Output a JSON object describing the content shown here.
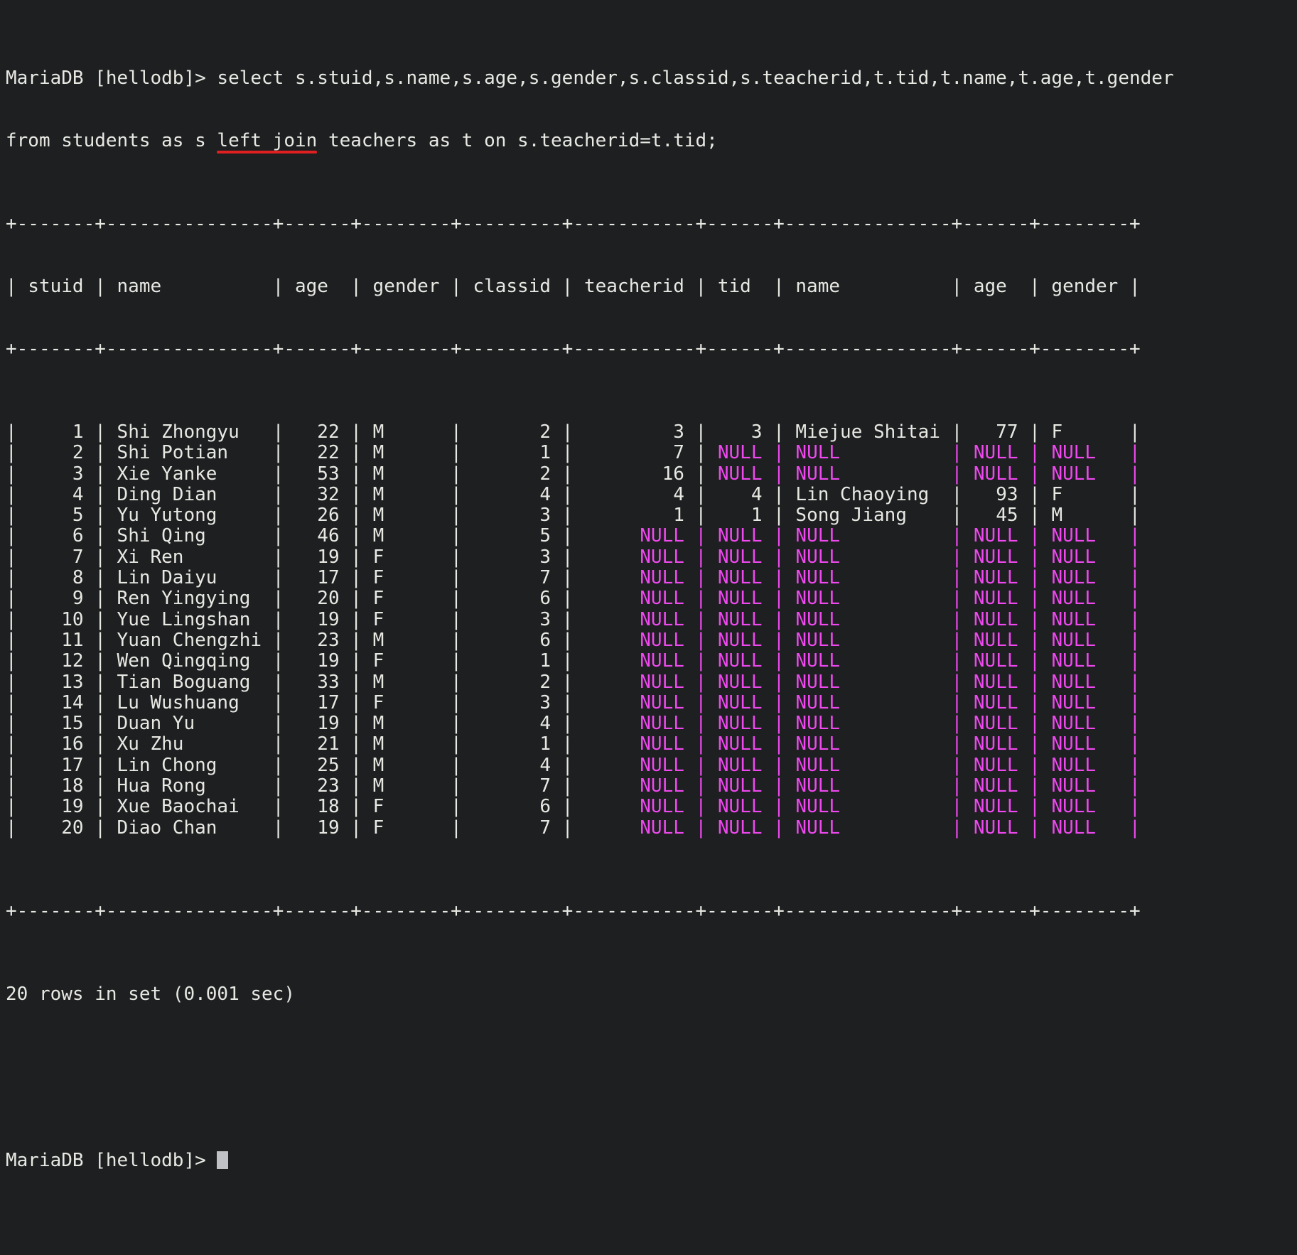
{
  "terminal": {
    "prompt": "MariaDB [hellodb]> ",
    "prompt_bare": "MariaDB [hellodb]>",
    "colors": {
      "background": "#1d1f21",
      "foreground": "#e8e8e3",
      "null_value": "#ef48ef",
      "annotation_underline": "#e02020",
      "cursor": "#bfc1c6"
    },
    "command_line_1": "MariaDB [hellodb]> select s.stuid,s.name,s.age,s.gender,s.classid,s.teacherid,t.tid,t.name,t.age,t.gender",
    "command_line_2": "from students as s left join teachers as t on s.teacherid=t.tid;",
    "sql_query": "select s.stuid,s.name,s.age,s.gender,s.classid,s.teacherid,t.tid,t.name,t.age,t.gender from students as s left join teachers as t on s.teacherid=t.tid;",
    "annotation": {
      "target_text": "left join",
      "type": "red-underline"
    },
    "result_footer": "20 rows in set (0.001 sec)",
    "row_count": 20,
    "elapsed": "0.001 sec",
    "final_prompt": "MariaDB [hellodb]> "
  },
  "table": {
    "separator": "+-------+---------------+------+--------+---------+-----------+------+---------------+------+--------+",
    "columns": [
      {
        "name": "stuid",
        "width": 5,
        "align": "right"
      },
      {
        "name": "name",
        "width": 13,
        "align": "left"
      },
      {
        "name": "age",
        "width": 4,
        "align": "right"
      },
      {
        "name": "gender",
        "width": 6,
        "align": "left"
      },
      {
        "name": "classid",
        "width": 7,
        "align": "right"
      },
      {
        "name": "teacherid",
        "width": 9,
        "align": "right"
      },
      {
        "name": "tid",
        "width": 4,
        "align": "right"
      },
      {
        "name": "name",
        "width": 13,
        "align": "left"
      },
      {
        "name": "age",
        "width": 4,
        "align": "right"
      },
      {
        "name": "gender",
        "width": 6,
        "align": "left"
      }
    ],
    "rows": [
      {
        "stuid": "1",
        "name": "Shi Zhongyu",
        "age": "22",
        "gender": "M",
        "classid": "2",
        "teacherid": "3",
        "tid": "3",
        "tname": "Miejue Shitai",
        "tage": "77",
        "tgender": "F"
      },
      {
        "stuid": "2",
        "name": "Shi Potian",
        "age": "22",
        "gender": "M",
        "classid": "1",
        "teacherid": "7",
        "tid": "NULL",
        "tname": "NULL",
        "tage": "NULL",
        "tgender": "NULL"
      },
      {
        "stuid": "3",
        "name": "Xie Yanke",
        "age": "53",
        "gender": "M",
        "classid": "2",
        "teacherid": "16",
        "tid": "NULL",
        "tname": "NULL",
        "tage": "NULL",
        "tgender": "NULL"
      },
      {
        "stuid": "4",
        "name": "Ding Dian",
        "age": "32",
        "gender": "M",
        "classid": "4",
        "teacherid": "4",
        "tid": "4",
        "tname": "Lin Chaoying",
        "tage": "93",
        "tgender": "F"
      },
      {
        "stuid": "5",
        "name": "Yu Yutong",
        "age": "26",
        "gender": "M",
        "classid": "3",
        "teacherid": "1",
        "tid": "1",
        "tname": "Song Jiang",
        "tage": "45",
        "tgender": "M"
      },
      {
        "stuid": "6",
        "name": "Shi Qing",
        "age": "46",
        "gender": "M",
        "classid": "5",
        "teacherid": "NULL",
        "tid": "NULL",
        "tname": "NULL",
        "tage": "NULL",
        "tgender": "NULL"
      },
      {
        "stuid": "7",
        "name": "Xi Ren",
        "age": "19",
        "gender": "F",
        "classid": "3",
        "teacherid": "NULL",
        "tid": "NULL",
        "tname": "NULL",
        "tage": "NULL",
        "tgender": "NULL"
      },
      {
        "stuid": "8",
        "name": "Lin Daiyu",
        "age": "17",
        "gender": "F",
        "classid": "7",
        "teacherid": "NULL",
        "tid": "NULL",
        "tname": "NULL",
        "tage": "NULL",
        "tgender": "NULL"
      },
      {
        "stuid": "9",
        "name": "Ren Yingying",
        "age": "20",
        "gender": "F",
        "classid": "6",
        "teacherid": "NULL",
        "tid": "NULL",
        "tname": "NULL",
        "tage": "NULL",
        "tgender": "NULL"
      },
      {
        "stuid": "10",
        "name": "Yue Lingshan",
        "age": "19",
        "gender": "F",
        "classid": "3",
        "teacherid": "NULL",
        "tid": "NULL",
        "tname": "NULL",
        "tage": "NULL",
        "tgender": "NULL"
      },
      {
        "stuid": "11",
        "name": "Yuan Chengzhi",
        "age": "23",
        "gender": "M",
        "classid": "6",
        "teacherid": "NULL",
        "tid": "NULL",
        "tname": "NULL",
        "tage": "NULL",
        "tgender": "NULL"
      },
      {
        "stuid": "12",
        "name": "Wen Qingqing",
        "age": "19",
        "gender": "F",
        "classid": "1",
        "teacherid": "NULL",
        "tid": "NULL",
        "tname": "NULL",
        "tage": "NULL",
        "tgender": "NULL"
      },
      {
        "stuid": "13",
        "name": "Tian Boguang",
        "age": "33",
        "gender": "M",
        "classid": "2",
        "teacherid": "NULL",
        "tid": "NULL",
        "tname": "NULL",
        "tage": "NULL",
        "tgender": "NULL"
      },
      {
        "stuid": "14",
        "name": "Lu Wushuang",
        "age": "17",
        "gender": "F",
        "classid": "3",
        "teacherid": "NULL",
        "tid": "NULL",
        "tname": "NULL",
        "tage": "NULL",
        "tgender": "NULL"
      },
      {
        "stuid": "15",
        "name": "Duan Yu",
        "age": "19",
        "gender": "M",
        "classid": "4",
        "teacherid": "NULL",
        "tid": "NULL",
        "tname": "NULL",
        "tage": "NULL",
        "tgender": "NULL"
      },
      {
        "stuid": "16",
        "name": "Xu Zhu",
        "age": "21",
        "gender": "M",
        "classid": "1",
        "teacherid": "NULL",
        "tid": "NULL",
        "tname": "NULL",
        "tage": "NULL",
        "tgender": "NULL"
      },
      {
        "stuid": "17",
        "name": "Lin Chong",
        "age": "25",
        "gender": "M",
        "classid": "4",
        "teacherid": "NULL",
        "tid": "NULL",
        "tname": "NULL",
        "tage": "NULL",
        "tgender": "NULL"
      },
      {
        "stuid": "18",
        "name": "Hua Rong",
        "age": "23",
        "gender": "M",
        "classid": "7",
        "teacherid": "NULL",
        "tid": "NULL",
        "tname": "NULL",
        "tage": "NULL",
        "tgender": "NULL"
      },
      {
        "stuid": "19",
        "name": "Xue Baochai",
        "age": "18",
        "gender": "F",
        "classid": "6",
        "teacherid": "NULL",
        "tid": "NULL",
        "tname": "NULL",
        "tage": "NULL",
        "tgender": "NULL"
      },
      {
        "stuid": "20",
        "name": "Diao Chan",
        "age": "19",
        "gender": "F",
        "classid": "7",
        "teacherid": "NULL",
        "tid": "NULL",
        "tname": "NULL",
        "tage": "NULL",
        "tgender": "NULL"
      }
    ]
  }
}
